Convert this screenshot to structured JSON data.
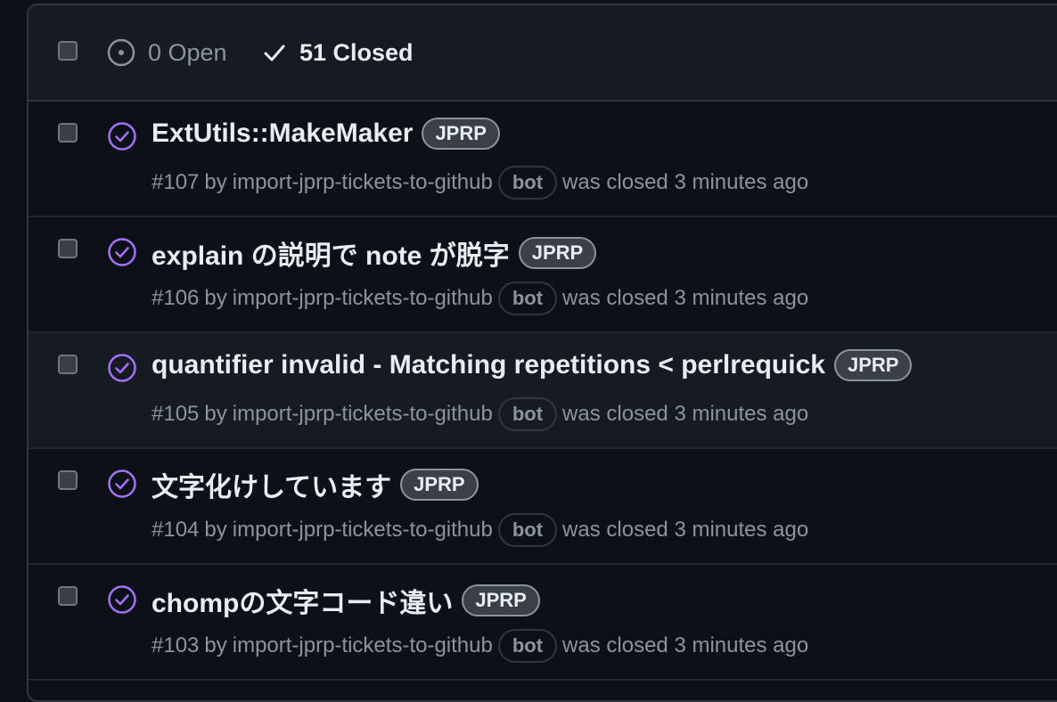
{
  "filters": {
    "open_label": "0 Open",
    "closed_label": "51 Closed"
  },
  "colors": {
    "closed_icon": "#a371f7",
    "open_icon": "#8b949e"
  },
  "issues": [
    {
      "title": "ExtUtils::MakeMaker",
      "label": "JPRP",
      "number": "#107",
      "by": "by",
      "author": "import-jprp-tickets-to-github",
      "badge": "bot",
      "status_text": "was closed 3 minutes ago"
    },
    {
      "title": "explain の説明で note が脱字",
      "label": "JPRP",
      "number": "#106",
      "by": "by",
      "author": "import-jprp-tickets-to-github",
      "badge": "bot",
      "status_text": "was closed 3 minutes ago"
    },
    {
      "title": "quantifier invalid - Matching repetitions < perlrequick",
      "label": "JPRP",
      "number": "#105",
      "by": "by",
      "author": "import-jprp-tickets-to-github",
      "badge": "bot",
      "status_text": "was closed 3 minutes ago"
    },
    {
      "title": "文字化けしています",
      "label": "JPRP",
      "number": "#104",
      "by": "by",
      "author": "import-jprp-tickets-to-github",
      "badge": "bot",
      "status_text": "was closed 3 minutes ago"
    },
    {
      "title": "chompの文字コード違い",
      "label": "JPRP",
      "number": "#103",
      "by": "by",
      "author": "import-jprp-tickets-to-github",
      "badge": "bot",
      "status_text": "was closed 3 minutes ago"
    }
  ]
}
